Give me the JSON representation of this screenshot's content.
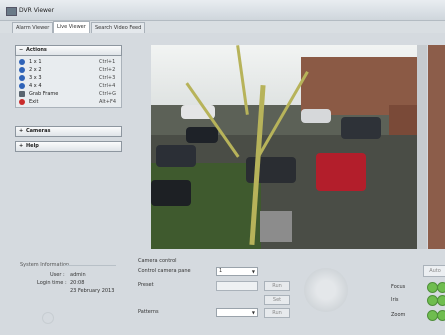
{
  "window": {
    "title": "DVR Viewer"
  },
  "tabs": [
    {
      "label": "Alarm Viewer"
    },
    {
      "label": "Live Viewer"
    },
    {
      "label": "Search Video Feed"
    }
  ],
  "sidebar": {
    "actions": {
      "title": "Actions",
      "items": [
        {
          "label": "1 x 1",
          "shortcut": "Ctrl+1",
          "icon": "layout-1x1-icon"
        },
        {
          "label": "2 x 2",
          "shortcut": "Ctrl+2",
          "icon": "layout-2x2-icon"
        },
        {
          "label": "3 x 3",
          "shortcut": "Ctrl+3",
          "icon": "layout-3x3-icon"
        },
        {
          "label": "4 x 4",
          "shortcut": "Ctrl+4",
          "icon": "layout-4x4-icon"
        },
        {
          "label": "Grab Frame",
          "shortcut": "Ctrl+G",
          "icon": "grab-frame-icon"
        },
        {
          "label": "Exit",
          "shortcut": "Alt+F4",
          "icon": "exit-icon"
        }
      ]
    },
    "cameras": {
      "title": "Cameras"
    },
    "help": {
      "title": "Help"
    }
  },
  "system_info": {
    "title": "System Information",
    "user_label": "User :",
    "user_value": "admin",
    "login_time_label": "Login time :",
    "login_time_value": "20:08",
    "login_date": "23 February 2013"
  },
  "camera_control": {
    "title": "Camera control",
    "control_pane_label": "Control camera pane",
    "control_pane_value": "1",
    "preset_label": "Preset",
    "patterns_label": "Patterns",
    "buttons": {
      "run": "Run",
      "set": "Set",
      "run2": "Run"
    },
    "focus_label": "Focus",
    "iris_label": "Iris",
    "zoom_label": "Zoom",
    "auto_label": "Auto"
  }
}
